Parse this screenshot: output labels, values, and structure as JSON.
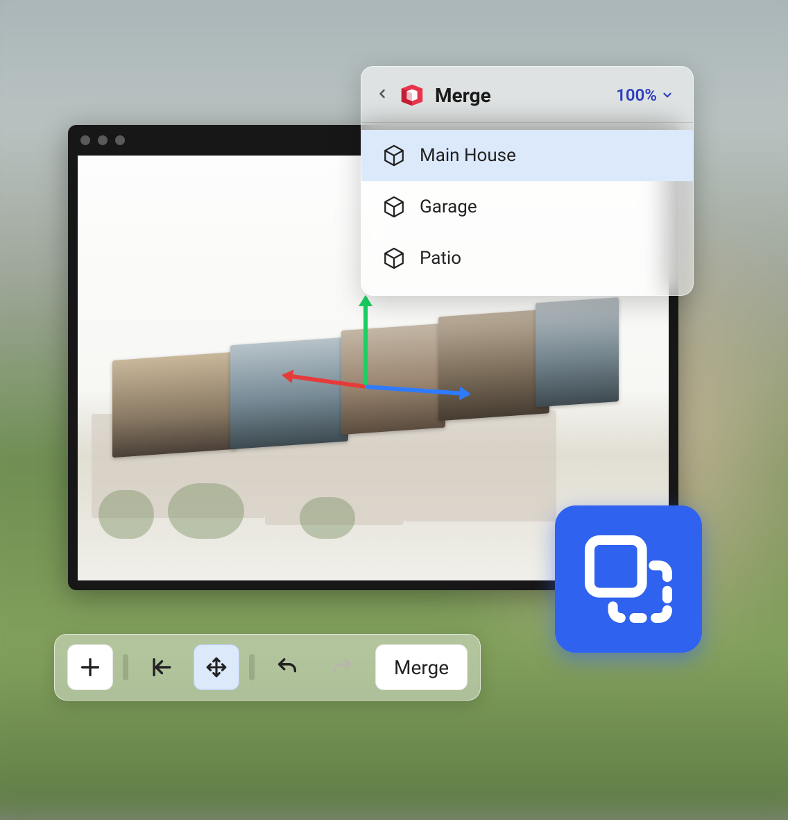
{
  "panel": {
    "title": "Merge",
    "zoom_label": "100%",
    "models": [
      {
        "label": "Main House",
        "selected": true
      },
      {
        "label": "Garage",
        "selected": false
      },
      {
        "label": "Patio",
        "selected": false
      }
    ]
  },
  "toolbar": {
    "merge_label": "Merge"
  },
  "icons": {
    "back": "chevron-left",
    "zoom_caret": "chevron-down",
    "logo": "matterport-logo",
    "box": "cube",
    "add": "plus",
    "reset": "arrow-bar-left",
    "move": "move-arrows",
    "undo": "undo",
    "redo": "redo",
    "badge": "merge-shapes"
  }
}
